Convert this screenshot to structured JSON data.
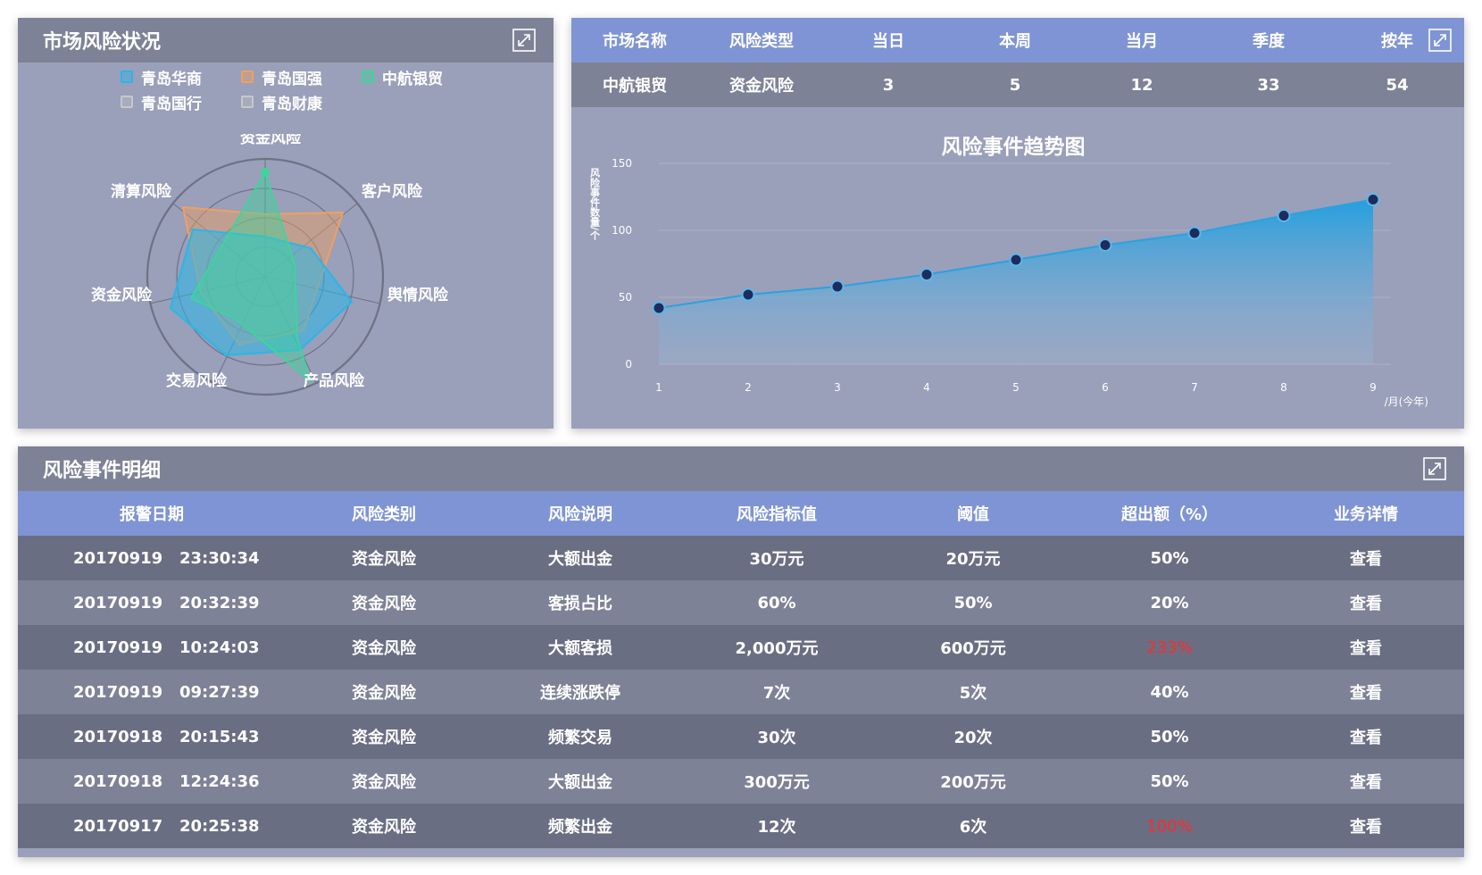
{
  "radar_panel": {
    "title": "市场风险状况",
    "legend": [
      {
        "name": "青岛华商",
        "color": "#29b6e8"
      },
      {
        "name": "青岛国强",
        "color": "#f0a060"
      },
      {
        "name": "中航银贸",
        "color": "#3fd49a"
      },
      {
        "name": "青岛国行",
        "color": "#c8c8c8"
      },
      {
        "name": "青岛财康",
        "color": "#c8c8c8"
      }
    ],
    "axes": [
      "资金风险",
      "客户风险",
      "舆情风险",
      "产品风险",
      "交易风险",
      "资金风险",
      "清算风险"
    ]
  },
  "summary": {
    "headers": [
      "市场名称",
      "风险类型",
      "当日",
      "本周",
      "当月",
      "季度",
      "按年"
    ],
    "row": [
      "中航银贸",
      "资金风险",
      "3",
      "5",
      "12",
      "33",
      "54"
    ]
  },
  "chart_data": {
    "type": "area",
    "title": "风险事件趋势图",
    "ylabel": "风险事件数量/个",
    "xlabel": "/月(今年)",
    "x": [
      1,
      2,
      3,
      4,
      5,
      6,
      7,
      8,
      9
    ],
    "y_ticks": [
      0,
      50,
      100,
      150
    ],
    "ylim": [
      0,
      150
    ],
    "series": [
      {
        "name": "",
        "values": [
          42,
          52,
          58,
          67,
          78,
          89,
          98,
          111,
          123
        ]
      }
    ],
    "color": "#2aa2e0"
  },
  "detail_panel": {
    "title": "风险事件明细",
    "headers": [
      "报警日期",
      "风险类别",
      "风险说明",
      "风险指标值",
      "阈值",
      "超出额（%）",
      "业务详情"
    ],
    "rows": [
      [
        "20170919   23:30:34",
        "资金风险",
        "大额出金",
        "30万元",
        "20万元",
        "50%",
        "查看"
      ],
      [
        "20170919   20:32:39",
        "资金风险",
        "客损占比",
        "60%",
        "50%",
        "20%",
        "查看"
      ],
      [
        "20170919   10:24:03",
        "资金风险",
        "大额客损",
        "2,000万元",
        "600万元",
        "233%",
        "查看"
      ],
      [
        "20170919   09:27:39",
        "资金风险",
        "连续涨跌停",
        "7次",
        "5次",
        "40%",
        "查看"
      ],
      [
        "20170918   20:15:43",
        "资金风险",
        "频繁交易",
        "30次",
        "20次",
        "50%",
        "查看"
      ],
      [
        "20170918   12:24:36",
        "资金风险",
        "大额出金",
        "300万元",
        "200万元",
        "50%",
        "查看"
      ],
      [
        "20170917   20:25:38",
        "资金风险",
        "频繁出金",
        "12次",
        "6次",
        "100%",
        "查看"
      ]
    ],
    "highlight_color": "#ff2a2a"
  }
}
